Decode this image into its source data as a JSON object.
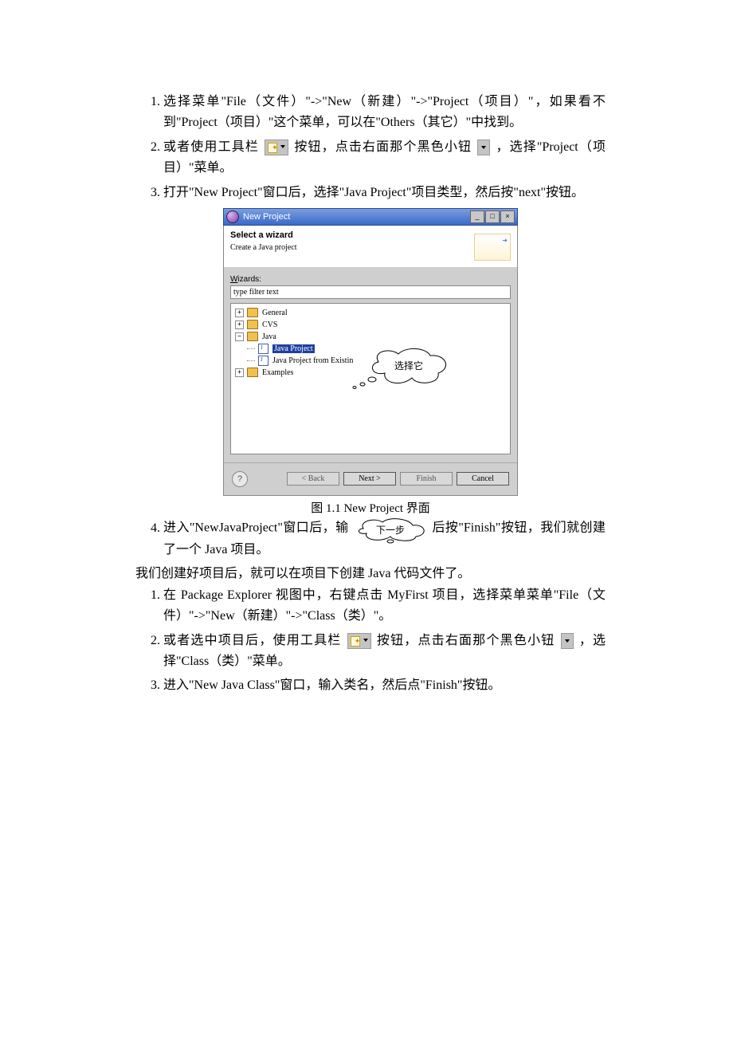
{
  "list1": {
    "item1": "选择菜单\"File（文件）\"->\"New（新建）\"->\"Project（项目）\"，如果看不到\"Project（项目）\"这个菜单，可以在\"Others（其它）\"中找到。",
    "item2_a": "或者使用工具栏",
    "item2_b": "按钮，点击右面那个黑色小钮",
    "item2_c": "，选择\"Project（项目）\"菜单。",
    "item3": "打开\"New Project\"窗口后，选择\"Java Project\"项目类型，然后按\"next\"按钮。"
  },
  "dialog": {
    "title": "New Project",
    "header_title": "Select a wizard",
    "header_sub": "Create a Java project",
    "wizards_label": "Wizards:",
    "filter_placeholder": "type filter text",
    "tree": {
      "general": "General",
      "cvs": "CVS",
      "java": "Java",
      "java_project": "Java Project",
      "java_existing": "Java Project from Existin",
      "examples": "Examples"
    },
    "cloud_text": "选择它",
    "buttons": {
      "back": "< Back",
      "next": "Next >",
      "finish": "Finish",
      "cancel": "Cancel"
    },
    "help": "?"
  },
  "caption": "图 1.1 New Project 界面",
  "list2_item4_a": "进入\"NewJavaProject\"窗口后，输",
  "cloud2_text": "下一步",
  "list2_item4_b": "后按\"Finish\"按钮，我们就创建了一个 Java 项目。",
  "para_after": "我们创建好项目后，就可以在项目下创建 Java 代码文件了。",
  "list3": {
    "item1": "在 Package Explorer 视图中，右键点击 MyFirst 项目，选择菜单菜单\"File（文件）\"->\"New（新建）\"->\"Class（类）\"。",
    "item2_a": "或者选中项目后，使用工具栏",
    "item2_b": "按钮，点击右面那个黑色小钮",
    "item2_c": "，选择\"Class（类）\"菜单。",
    "item3": "进入\"New Java Class\"窗口，输入类名，然后点\"Finish\"按钮。"
  }
}
